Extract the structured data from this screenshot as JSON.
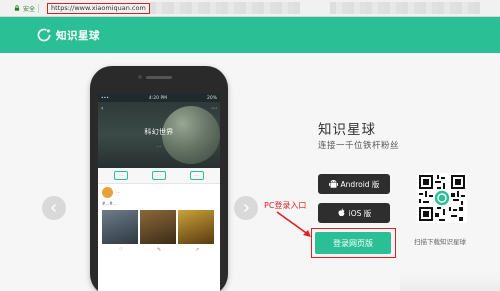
{
  "browser": {
    "secure_label": "安全",
    "url": "https://www.xiaomiquan.com"
  },
  "header": {
    "brand": "知识星球",
    "bg_color": "#2bbf95"
  },
  "phone": {
    "status_time": "4:20 PM",
    "status_battery": "20%",
    "hero_title": "科幻世界",
    "hero_subtitle": "…",
    "tabs": [
      "…",
      "…",
      "…"
    ],
    "post_author": "…",
    "post_text": "#…#…",
    "actions": [
      "♡",
      "✎",
      "↗"
    ]
  },
  "product": {
    "title": "知识星球",
    "subtitle": "连接一千位铁杆粉丝"
  },
  "downloads": {
    "android_label": "Android 版",
    "ios_label": "iOS 版",
    "web_label": "登录网页版"
  },
  "annotation": {
    "pc_login_label": "PC登录入口",
    "color": "#e02020"
  },
  "qr": {
    "caption": "扫描下载知识星球"
  },
  "icons": {
    "logo": "planet-ring-icon",
    "android": "android-icon",
    "ios": "apple-icon",
    "prev": "chevron-left-icon",
    "next": "chevron-right-icon"
  }
}
